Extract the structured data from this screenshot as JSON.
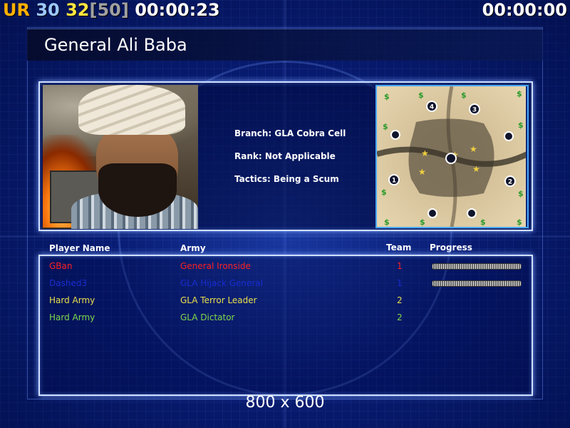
{
  "hud": {
    "label": "UR",
    "count_a": "30",
    "count_b": "32",
    "count_max": "[50]",
    "timer_left": "00:00:23",
    "timer_right": "00:00:00"
  },
  "general": {
    "title": "General Ali Baba",
    "branch": "Branch: GLA Cobra Cell",
    "rank": "Rank: Not Applicable",
    "tactics": "Tactics: Being a Scum"
  },
  "minimap": {
    "player_starts": [
      "1",
      "2",
      "3",
      "4"
    ],
    "icon_money": "$",
    "icon_star": "★"
  },
  "players_table": {
    "headers": {
      "player_name": "Player Name",
      "army": "Army",
      "team": "Team",
      "progress": "Progress"
    },
    "rows": [
      {
        "name": "GBan",
        "army": "General Ironside",
        "team": "1",
        "color": "#ff2020",
        "progress_visible": true
      },
      {
        "name": "Dashed3",
        "army": "GLA Hijack General",
        "team": "1",
        "color": "#1a2cd0",
        "progress_visible": true
      },
      {
        "name": "Hard Army",
        "army": "GLA Terror Leader",
        "team": "2",
        "color": "#e8e04a",
        "progress_visible": false
      },
      {
        "name": "Hard Army",
        "army": "GLA Dictator",
        "team": "2",
        "color": "#7ed84a",
        "progress_visible": false
      }
    ]
  },
  "footer": {
    "resolution": "800 x 600"
  },
  "colors": {
    "hud_orange": "#ffb000",
    "hud_blue": "#9cc8ff",
    "hud_yellow": "#ffe640",
    "hud_grey": "#a0a0a0",
    "panel_border": "#cfe0ff",
    "minimap_border": "#4aa8ff"
  }
}
